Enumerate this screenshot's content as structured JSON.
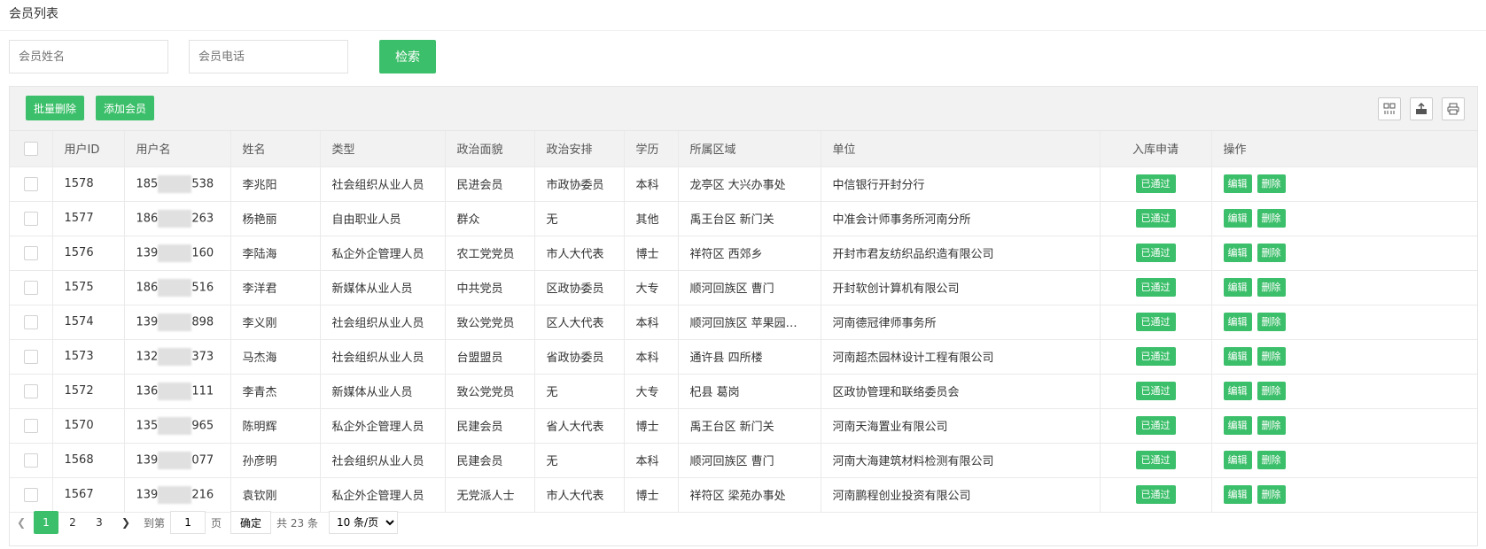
{
  "page": {
    "title": "会员列表"
  },
  "search": {
    "name_placeholder": "会员姓名",
    "phone_placeholder": "会员电话",
    "button_label": "检索"
  },
  "toolbar": {
    "batch_delete_label": "批量删除",
    "add_member_label": "添加会员",
    "icons": [
      "columns-icon",
      "export-icon",
      "print-icon"
    ]
  },
  "table": {
    "columns": [
      "",
      "用户ID",
      "用户名",
      "姓名",
      "类型",
      "政治面貌",
      "政治安排",
      "学历",
      "所属区域",
      "单位",
      "入库申请",
      "操作"
    ],
    "status_label": "已通过",
    "edit_label": "编辑",
    "delete_label": "删除",
    "rows": [
      {
        "id": "1578",
        "phone_prefix": "185",
        "phone_suffix": "538",
        "name": "李兆阳",
        "type": "社会组织从业人员",
        "political": "民进会员",
        "arrangement": "市政协委员",
        "education": "本科",
        "region": "龙亭区 大兴办事处",
        "unit": "中信银行开封分行"
      },
      {
        "id": "1577",
        "phone_prefix": "186",
        "phone_suffix": "263",
        "name": "杨艳丽",
        "type": "自由职业人员",
        "political": "群众",
        "arrangement": "无",
        "education": "其他",
        "region": "禹王台区 新门关",
        "unit": "中准会计师事务所河南分所"
      },
      {
        "id": "1576",
        "phone_prefix": "139",
        "phone_suffix": "160",
        "name": "李陆海",
        "type": "私企外企管理人员",
        "political": "农工党党员",
        "arrangement": "市人大代表",
        "education": "博士",
        "region": "祥符区 西郊乡",
        "unit": "开封市君友纺织品织造有限公司"
      },
      {
        "id": "1575",
        "phone_prefix": "186",
        "phone_suffix": "516",
        "name": "李洋君",
        "type": "新媒体从业人员",
        "political": "中共党员",
        "arrangement": "区政协委员",
        "education": "大专",
        "region": "顺河回族区 曹门",
        "unit": "开封软创计算机有限公司"
      },
      {
        "id": "1574",
        "phone_prefix": "139",
        "phone_suffix": "898",
        "name": "李义刚",
        "type": "社会组织从业人员",
        "political": "致公党党员",
        "arrangement": "区人大代表",
        "education": "本科",
        "region": "顺河回族区 苹果园街道",
        "unit": "河南德冠律师事务所"
      },
      {
        "id": "1573",
        "phone_prefix": "132",
        "phone_suffix": "373",
        "name": "马杰海",
        "type": "社会组织从业人员",
        "political": "台盟盟员",
        "arrangement": "省政协委员",
        "education": "本科",
        "region": "通许县 四所楼",
        "unit": "河南超杰园林设计工程有限公司"
      },
      {
        "id": "1572",
        "phone_prefix": "136",
        "phone_suffix": "111",
        "name": "李青杰",
        "type": "新媒体从业人员",
        "political": "致公党党员",
        "arrangement": "无",
        "education": "大专",
        "region": "杞县 葛岗",
        "unit": "区政协管理和联络委员会"
      },
      {
        "id": "1570",
        "phone_prefix": "135",
        "phone_suffix": "965",
        "name": "陈明辉",
        "type": "私企外企管理人员",
        "political": "民建会员",
        "arrangement": "省人大代表",
        "education": "博士",
        "region": "禹王台区 新门关",
        "unit": "河南天海置业有限公司"
      },
      {
        "id": "1568",
        "phone_prefix": "139",
        "phone_suffix": "077",
        "name": "孙彦明",
        "type": "社会组织从业人员",
        "political": "民建会员",
        "arrangement": "无",
        "education": "本科",
        "region": "顺河回族区 曹门",
        "unit": "河南大海建筑材料检测有限公司"
      },
      {
        "id": "1567",
        "phone_prefix": "139",
        "phone_suffix": "216",
        "name": "袁钦刚",
        "type": "私企外企管理人员",
        "political": "无党派人士",
        "arrangement": "市人大代表",
        "education": "博士",
        "region": "祥符区 梁苑办事处",
        "unit": "河南鹏程创业投资有限公司"
      }
    ]
  },
  "pagination": {
    "pages": [
      "1",
      "2",
      "3"
    ],
    "current": "1",
    "goto_label": "到第",
    "page_label": "页",
    "goto_value": "1",
    "confirm_label": "确定",
    "total_label": "共 23 条",
    "page_size": "10 条/页"
  },
  "colors": {
    "accent": "#3cbf6a",
    "header_bg": "#f2f2f2",
    "border": "#eaeaea"
  }
}
